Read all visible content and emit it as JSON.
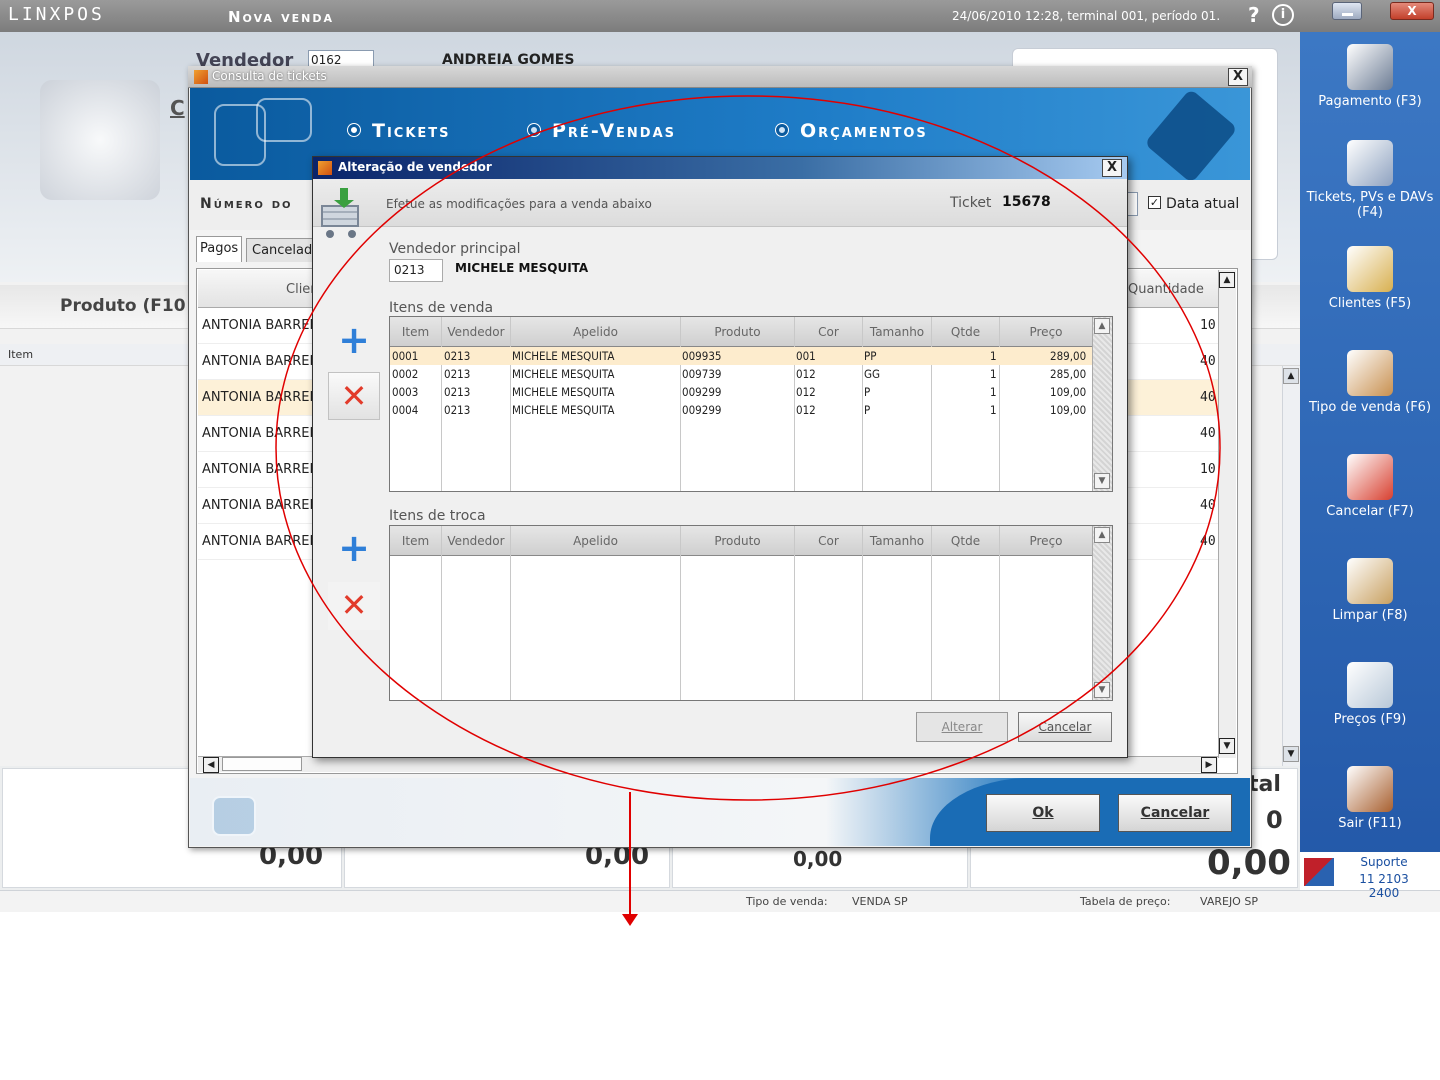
{
  "topbar": {
    "logo": "LINXPOS",
    "app_title": "Nova venda",
    "status": "24/06/2010 12:28, terminal 001, período 01.",
    "help": "?",
    "info": "i",
    "close": "X"
  },
  "background": {
    "vendedor_label": "Vendedor",
    "vendedor_code": "0162",
    "vendedor_name": "ANDREIA GOMES",
    "c_letter": "C",
    "produto_label": "Produto (F10",
    "item_column": "Item",
    "totals": [
      "0,00",
      "0,00",
      "0,00",
      "0,00"
    ],
    "total_label": "tal",
    "total_zero": "0",
    "status_tipo_label": "Tipo de venda:",
    "status_tipo_value": "VENDA SP",
    "status_tabela_label": "Tabela de preço:",
    "status_tabela_value": "VAREJO SP"
  },
  "sidebar": {
    "items": [
      {
        "label": "Pagamento (F3)",
        "icon": "payment-icon",
        "color": "#6c7c94"
      },
      {
        "label": "Tickets, PVs e DAVs (F4)",
        "icon": "tickets-icon",
        "color": "#8ea2c0"
      },
      {
        "label": "Clientes (F5)",
        "icon": "clients-icon",
        "color": "#d8b050"
      },
      {
        "label": "Tipo de venda (F6)",
        "icon": "sale-type-icon",
        "color": "#c89050"
      },
      {
        "label": "Cancelar (F7)",
        "icon": "cancel-icon",
        "color": "#d84030"
      },
      {
        "label": "Limpar (F8)",
        "icon": "broom-icon",
        "color": "#c8a060"
      },
      {
        "label": "Preços (F9)",
        "icon": "magnifier-icon",
        "color": "#b8c8d8"
      },
      {
        "label": "Sair (F11)",
        "icon": "exit-door-icon",
        "color": "#a86030"
      }
    ],
    "support_label": "Suporte",
    "support_phone": "11 2103 2400"
  },
  "consulta": {
    "title": "Consulta de tickets",
    "close": "X",
    "radios": [
      "Tickets",
      "Pré-Vendas",
      "Orçamentos"
    ],
    "numero_label": "Número do",
    "data_atual_label": "Data atual",
    "tabs": [
      "Pagos",
      "Cancelado"
    ],
    "col_cliente": "Clier",
    "col_quantidade": "Quantidade",
    "rows": [
      {
        "client": "ANTONIA BARREI",
        "qty": "10"
      },
      {
        "client": "ANTONIA BARREI",
        "qty": "40"
      },
      {
        "client": "ANTONIA BARREI",
        "qty": "40"
      },
      {
        "client": "ANTONIA BARREI",
        "qty": "40"
      },
      {
        "client": "ANTONIA BARREI",
        "qty": "10"
      },
      {
        "client": "ANTONIA BARREI",
        "qty": "40"
      },
      {
        "client": "ANTONIA BARREI",
        "qty": "40"
      }
    ],
    "ok_label": "Ok",
    "cancelar_label": "Cancelar"
  },
  "alteracao": {
    "title": "Alteração de vendedor",
    "close": "X",
    "instructions": "Efetue as modificações para a venda abaixo",
    "ticket_label": "Ticket",
    "ticket_number": "15678",
    "vendedor_principal_label": "Vendedor principal",
    "vendedor_principal_code": "0213",
    "vendedor_principal_name": "MICHELE MESQUITA",
    "itens_venda_label": "Itens de venda",
    "itens_troca_label": "Itens de troca",
    "columns": [
      "Item",
      "Vendedor",
      "Apelido",
      "Produto",
      "Cor",
      "Tamanho",
      "Qtde",
      "Preço"
    ],
    "venda_rows": [
      {
        "item": "0001",
        "vendedor": "0213",
        "apelido": "MICHELE MESQUITA",
        "produto": "009935",
        "cor": "001",
        "tamanho": "PP",
        "qtde": "1",
        "preco": "289,00"
      },
      {
        "item": "0002",
        "vendedor": "0213",
        "apelido": "MICHELE MESQUITA",
        "produto": "009739",
        "cor": "012",
        "tamanho": "GG",
        "qtde": "1",
        "preco": "285,00"
      },
      {
        "item": "0003",
        "vendedor": "0213",
        "apelido": "MICHELE MESQUITA",
        "produto": "009299",
        "cor": "012",
        "tamanho": "P",
        "qtde": "1",
        "preco": "109,00"
      },
      {
        "item": "0004",
        "vendedor": "0213",
        "apelido": "MICHELE MESQUITA",
        "produto": "009299",
        "cor": "012",
        "tamanho": "P",
        "qtde": "1",
        "preco": "109,00"
      }
    ],
    "alterar_label": "Alterar",
    "cancelar_label": "Cancelar"
  },
  "annotation": {
    "color": "#e00000",
    "shape": "ellipse-with-down-arrow"
  }
}
